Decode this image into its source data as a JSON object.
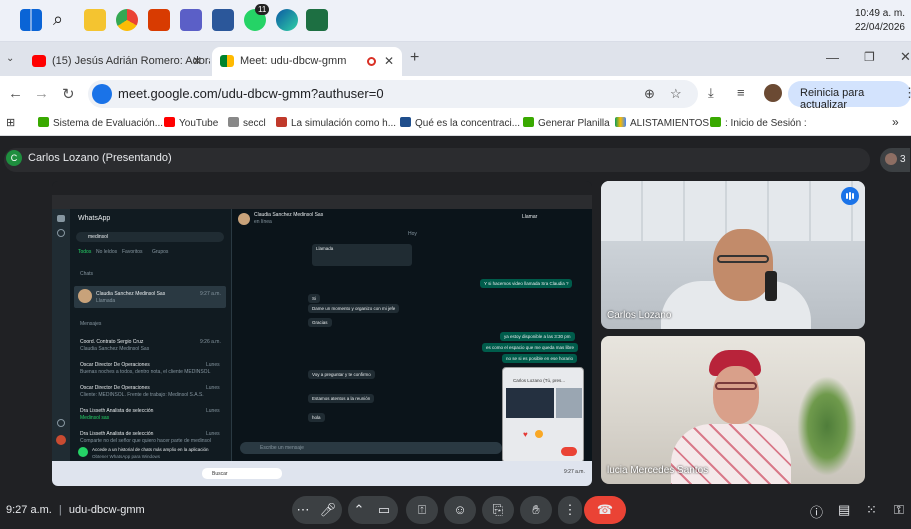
{
  "taskbar": {
    "clock_time": "10:49 a. m.",
    "clock_date": "22/04/2026",
    "notification_count": "11"
  },
  "browser": {
    "tabs": [
      {
        "label": "(15) Jesús Adrián Romero: Adoraci",
        "close": "✕"
      },
      {
        "label": "Meet: udu-dbcw-gmm",
        "close": "✕"
      }
    ],
    "new_tab": "+",
    "url": "meet.google.com/udu-dbcw-gmm?authuser=0",
    "update_button": "Reinicia para actualizar",
    "bookmarks": [
      "Sistema de Evaluación...",
      "YouTube",
      "seccl",
      "La simulación como h...",
      "Qué es la concentraci...",
      "Generar Planilla",
      "ALISTAMIENTOS",
      ": Inicio de Sesión :"
    ],
    "bookmarks_more": "»"
  },
  "meet": {
    "presenter_initial": "C",
    "presenting_label": "Carlos Lozano (Presentando)",
    "participant_count": "3",
    "meeting_time": "9:27 a.m.",
    "meeting_code": "udu-dbcw-gmm",
    "participants": [
      {
        "name": "Carlos Lozano"
      },
      {
        "name": "lucia Mercedes Santos"
      }
    ]
  },
  "shared_screen": {
    "app_title": "WhatsApp",
    "search_value": "medinsol",
    "filters": [
      "Todos",
      "No leídos",
      "Favoritos",
      "Grupos"
    ],
    "section_chats": "Chats",
    "section_messages": "Mensajes",
    "chats": [
      {
        "name": "Claudia Sanchez Medinsol Sas",
        "snippet": "Llamada",
        "time": "9:27 a.m."
      }
    ],
    "messages": [
      {
        "name": "Coord. Contrato Sergio Cruz",
        "snippet": "Claudia Sanchez Medinsol Sas",
        "time": "9:26 a.m."
      },
      {
        "name": "Oscar Director De Operaciones",
        "snippet": "Buenas noches a todos, dentro nota, el cliente MEDINSOL",
        "time": "Lunes"
      },
      {
        "name": "Oscar Director De Operaciones",
        "snippet": "Cliente: MEDINSOL. Frente de trabajo: Medinsol S.A.S.",
        "time": "Lunes"
      },
      {
        "name": "Dra Lisseth Analista de selección",
        "snippet": "Medinsol sas",
        "time": "Lunes"
      },
      {
        "name": "Dra Lisseth Analista de selección",
        "snippet": "Comparte no del señor que quiero hacer parte de medinsol",
        "time": "Lunes"
      }
    ],
    "banner": "Accede a un historial de chats más amplio en la aplicación",
    "banner_link": "Obtener WhatsApp para Windows",
    "chat_header_name": "Claudia Sanchez Medinsol Sas",
    "chat_header_status": "en línea",
    "call_button": "Llamar",
    "day_label": "Hoy",
    "bubbles_in": [
      "Llamada",
      "Si",
      "Dame un momento y organizo con mi jefe",
      "Gracias",
      "Voy a preguntar y te confirmo",
      "Estamos atentos a la reunión",
      "hola"
    ],
    "bubbles_out": [
      "Y si hacemos video llamada Sra Claudia ?",
      "ya estoy disponible a las 3:30 pm",
      "es como el espacio que me queda mas libre",
      "no se si es posible en ese horario"
    ],
    "input_placeholder": "Escribe un mensaje",
    "mini_title": "Carlos Lozano (Tú, pres...",
    "windows_search": "Buscar",
    "windows_clock": "9:27 a.m."
  }
}
